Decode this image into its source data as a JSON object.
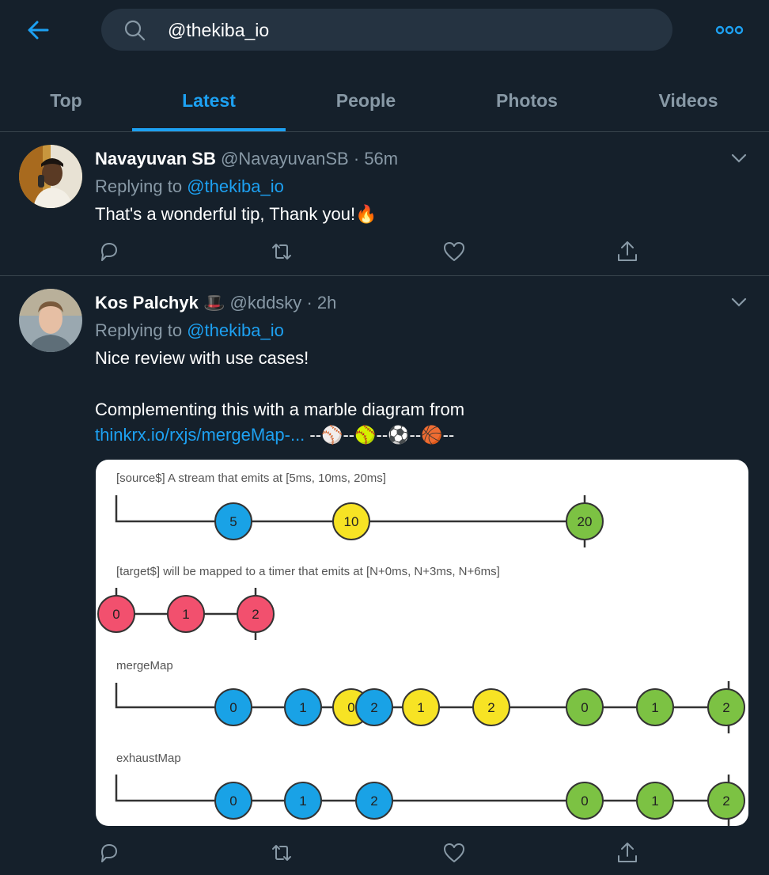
{
  "search": {
    "value": "@thekiba_io",
    "icon": "search-icon"
  },
  "header": {
    "back_icon": "arrow-left-icon",
    "more_icon": "more-dots-icon"
  },
  "tabs": [
    {
      "label": "Top",
      "active": false
    },
    {
      "label": "Latest",
      "active": true
    },
    {
      "label": "People",
      "active": false
    },
    {
      "label": "Photos",
      "active": false
    },
    {
      "label": "Videos",
      "active": false
    }
  ],
  "tweets": [
    {
      "name": "Navayuvan SB",
      "handle": "@NavayuvanSB",
      "separator": "·",
      "time": "56m",
      "replying_label": "Replying to",
      "replying_to": "@thekiba_io",
      "text": "That's a wonderful tip, Thank you!",
      "emoji": "🔥"
    },
    {
      "name": "Kos Palchyk",
      "name_emoji": "🎩",
      "handle": "@kddsky",
      "separator": "·",
      "time": "2h",
      "replying_label": "Replying to",
      "replying_to": "@thekiba_io",
      "text_line1": "Nice review with use cases!",
      "text_line2": "Complementing this with a marble diagram from",
      "link": "thinkrx.io/rxjs/mergeMap-...",
      "link_suffix": " --⚾--🥎--⚽--🏀--",
      "media": {
        "rows": [
          {
            "label": "[source$] A stream that emits at [5ms, 10ms, 20ms]",
            "marbles": [
              "5",
              "10",
              "20"
            ]
          },
          {
            "label": "[target$] will be mapped to a timer that emits at [N+0ms, N+3ms, N+6ms]",
            "marbles": [
              "0",
              "1",
              "2"
            ]
          },
          {
            "label": "mergeMap",
            "marbles": [
              "0",
              "1",
              "0",
              "2",
              "1",
              "2",
              "0",
              "1",
              "2"
            ]
          },
          {
            "label": "exhaustMap",
            "marbles": [
              "0",
              "1",
              "2",
              "0",
              "1",
              "2"
            ]
          }
        ],
        "colors": {
          "blue": "#19a2e6",
          "yellow": "#f7e324",
          "green": "#7cc243",
          "red": "#f2506e"
        }
      }
    }
  ],
  "actions": {
    "reply_icon": "reply-icon",
    "retweet_icon": "retweet-icon",
    "like_icon": "heart-icon",
    "share_icon": "share-icon"
  },
  "colors": {
    "background": "#15202b",
    "accent": "#1da1f2",
    "muted": "#8899a6",
    "divider": "#38444d"
  }
}
